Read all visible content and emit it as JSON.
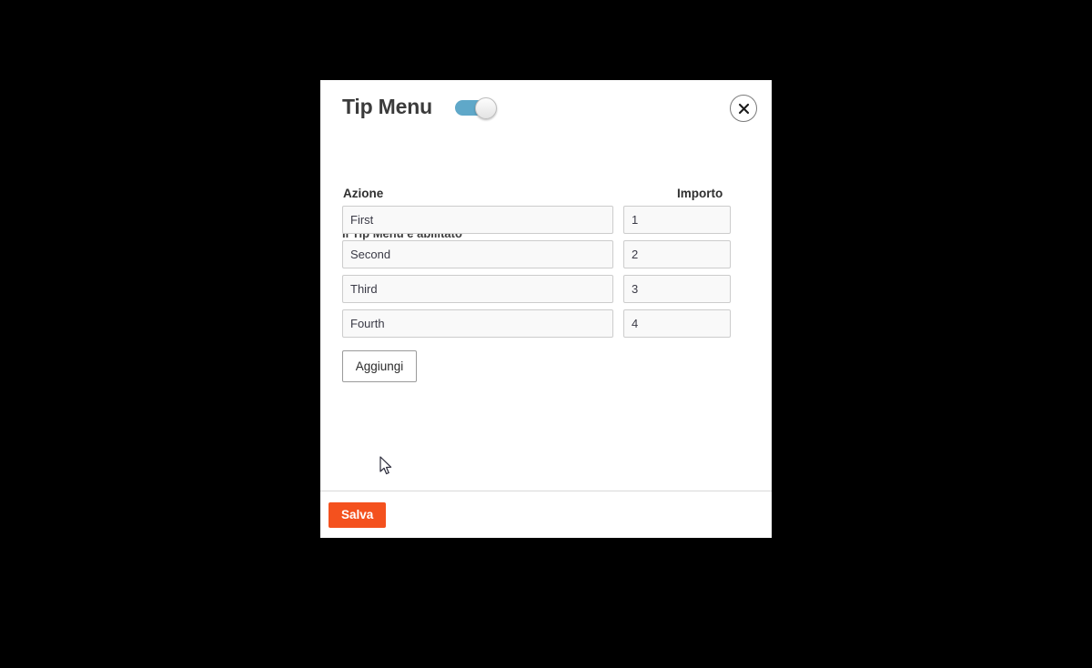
{
  "modal": {
    "title": "Tip Menu",
    "toggle": {
      "state": "on",
      "track_color": "#5fa8c9"
    },
    "close_label": "×",
    "subtitle": "Il Tip Menu è abilitato",
    "table": {
      "headers": {
        "action": "Azione",
        "amount": "Importo"
      },
      "rows": [
        {
          "action": "First",
          "amount": "1"
        },
        {
          "action": "Second",
          "amount": "2"
        },
        {
          "action": "Third",
          "amount": "3"
        },
        {
          "action": "Fourth",
          "amount": "4"
        }
      ]
    },
    "add_button": "Aggiungi",
    "footer": {
      "save_label": "Salva",
      "save_color": "#f4511e"
    }
  }
}
